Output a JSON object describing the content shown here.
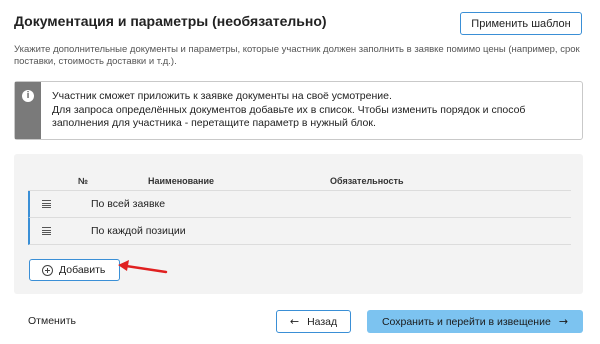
{
  "header": {
    "title": "Документация и параметры (необязательно)",
    "apply_template_label": "Применить шаблон",
    "subtitle_line1": "Укажите дополнительные документы и параметры, которые участник должен заполнить в заявке помимо цены (например, срок",
    "subtitle_line2": "поставки, стоимость доставки и т.д.)."
  },
  "info": {
    "icon": "info-icon",
    "lines": [
      "Участник сможет приложить к заявке документы на своё усмотрение.",
      "Для запроса определённых документов добавьте их в список. Чтобы изменить порядок и способ",
      "заполнения для участника - перетащите параметр в нужный блок."
    ]
  },
  "table": {
    "columns": [
      "№",
      "Наименование",
      "Обязательность"
    ],
    "rows": [
      {
        "label": "По всей заявке",
        "icon": "drag-handle-icon"
      },
      {
        "label": "По каждой позиции",
        "icon": "drag-handle-icon"
      }
    ],
    "add_label": "Добавить"
  },
  "footer": {
    "cancel_label": "Отменить",
    "back_label": "Назад",
    "save_label": "Сохранить и перейти в извещение"
  },
  "colors": {
    "accent": "#3a8fd6",
    "primary_button": "#7cc3f0",
    "info_bar": "#7a7a7a",
    "panel_bg": "#f3f3f3",
    "annotation_arrow": "#e02020"
  }
}
